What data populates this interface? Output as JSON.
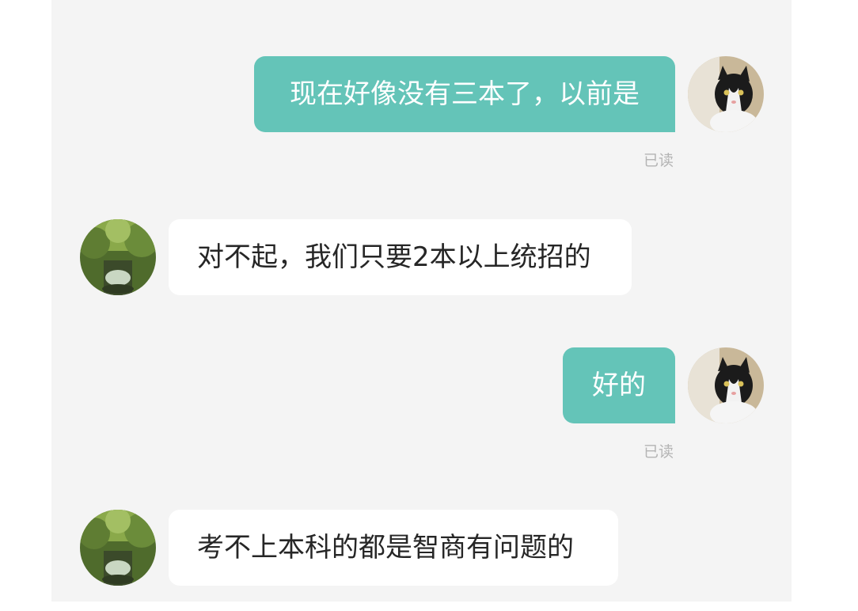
{
  "conversation": {
    "messages": [
      {
        "sender": "me",
        "text": "现在好像没有三本了，以前是",
        "status": "已读",
        "avatar": "cat-avatar"
      },
      {
        "sender": "them",
        "text": "对不起，我们只要2本以上统招的",
        "avatar": "forest-avatar"
      },
      {
        "sender": "me",
        "text": "好的",
        "status": "已读",
        "avatar": "cat-avatar"
      },
      {
        "sender": "them",
        "text": "考不上本科的都是智商有问题的",
        "avatar": "forest-avatar"
      }
    ]
  },
  "colors": {
    "outgoing_bubble": "#64c4b8",
    "incoming_bubble": "#ffffff",
    "chat_background": "#f4f4f4",
    "status_text": "#b4b4b4"
  }
}
